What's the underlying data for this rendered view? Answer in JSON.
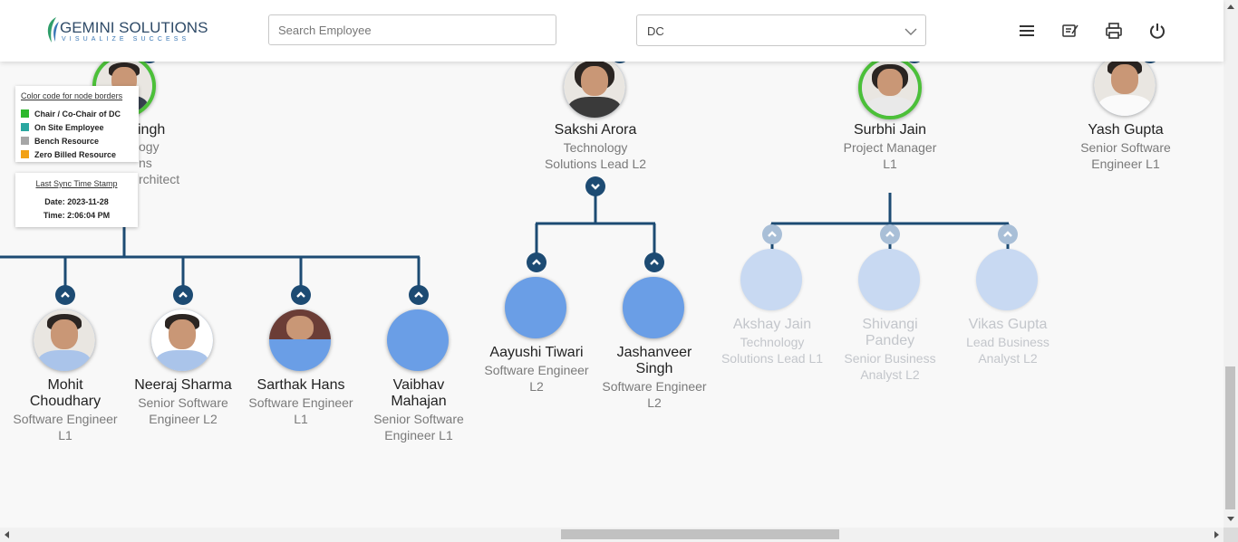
{
  "header": {
    "logo": {
      "name": "GEMINI SOLUTIONS",
      "tagline": "VISUALIZE SUCCESS"
    },
    "search": {
      "placeholder": "Search Employee",
      "value": ""
    },
    "dc_select": {
      "selected": "DC"
    },
    "icons": [
      "menu-icon",
      "notes-icon",
      "print-icon",
      "power-icon"
    ]
  },
  "legend": {
    "title": "Color code for node borders",
    "items": [
      {
        "label": "Chair / Co-Chair of DC",
        "color": "#2db82d"
      },
      {
        "label": "On Site Employee",
        "color": "#2aa7a0"
      },
      {
        "label": "Bench Resource",
        "color": "#a6a6a6"
      },
      {
        "label": "Zero Billed Resource",
        "color": "#f2a115"
      }
    ]
  },
  "sync": {
    "title": "Last Sync Time Stamp",
    "date": "Date: 2023-11-28",
    "time": "Time: 2:06:04 PM"
  },
  "partial_node": {
    "name_tail": "ingh",
    "line1_tail": "ogy",
    "line2_tail": "ns",
    "line3_tail": "rchitect"
  },
  "top_nodes": [
    {
      "name": "Sakshi Arora",
      "line1": "Technology",
      "line2": "Solutions Lead L2"
    },
    {
      "name": "Surbhi Jain",
      "line1": "Project Manager",
      "line2": "L1"
    },
    {
      "name": "Yash Gupta",
      "line1": "Senior Software",
      "line2": "Engineer L1"
    }
  ],
  "left_children": [
    {
      "name1": "Mohit",
      "name2": "Choudhary",
      "line1": "Software Engineer",
      "line2": "L1"
    },
    {
      "name1": "Neeraj Sharma",
      "name2": "",
      "line1": "Senior Software",
      "line2": "Engineer L2"
    },
    {
      "name1": "Sarthak Hans",
      "name2": "",
      "line1": "Software Engineer",
      "line2": "L1"
    },
    {
      "name1": "Vaibhav",
      "name2": "Mahajan",
      "line1": "Senior Software",
      "line2": "Engineer L1"
    }
  ],
  "sakshi_children": [
    {
      "name1": "Aayushi Tiwari",
      "name2": "",
      "line1": "Software Engineer",
      "line2": "L2"
    },
    {
      "name1": "Jashanveer",
      "name2": "Singh",
      "line1": "Software Engineer",
      "line2": "L2"
    }
  ],
  "surbhi_children": [
    {
      "name1": "Akshay Jain",
      "name2": "",
      "line1": "Technology",
      "line2": "Solutions Lead L1"
    },
    {
      "name1": "Shivangi",
      "name2": "Pandey",
      "line1": "Senior Business",
      "line2": "Analyst L2"
    },
    {
      "name1": "Vikas Gupta",
      "name2": "",
      "line1": "Lead Business",
      "line2": "Analyst L2"
    }
  ]
}
